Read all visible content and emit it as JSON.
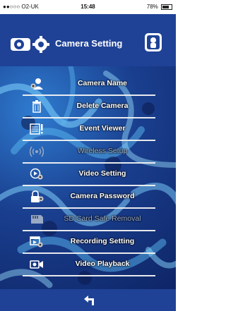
{
  "status_bar": {
    "carrier": "●●○○○ O2-UK",
    "time": "15:48",
    "battery": "78%"
  },
  "header": {
    "title": "Camera Setting"
  },
  "menu": {
    "items": [
      {
        "label": "Camera Name",
        "icon": "user-gear-icon",
        "enabled": true
      },
      {
        "label": "Delete Camera",
        "icon": "trash-icon",
        "enabled": true
      },
      {
        "label": "Event Viewer",
        "icon": "event-list-icon",
        "enabled": true
      },
      {
        "label": "Wireless Setup",
        "icon": "wireless-icon",
        "enabled": false
      },
      {
        "label": "Video Setting",
        "icon": "video-gear-icon",
        "enabled": true
      },
      {
        "label": "Camera Password",
        "icon": "lock-gear-icon",
        "enabled": true
      },
      {
        "label": "SD Card Safe Removal",
        "icon": "sd-card-icon",
        "enabled": false
      },
      {
        "label": "Recording Setting",
        "icon": "film-gear-icon",
        "enabled": true
      },
      {
        "label": "Video Playback",
        "icon": "video-camera-icon",
        "enabled": true
      }
    ]
  },
  "colors": {
    "header_blue": "#1f4296",
    "divider": "#f2f2f2",
    "disabled_text": "#9aa9c4"
  }
}
